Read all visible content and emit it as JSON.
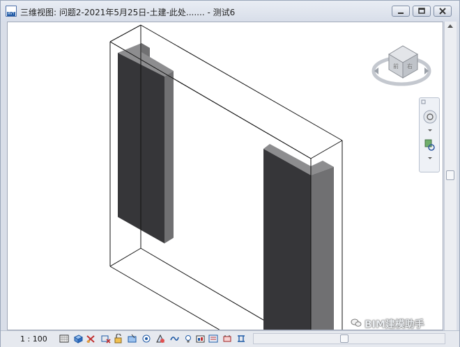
{
  "window": {
    "title": "三维视图: 问题2-2021年5月25日-土建-此处....... - 测试6",
    "app_icon": "RVT"
  },
  "status": {
    "scale": "1 : 100"
  },
  "viewcube": {
    "faces": [
      "前",
      "右"
    ]
  },
  "watermark": {
    "text": "BIM建模助手"
  },
  "toolbar_icons": [
    "visual-style-icon",
    "shadows-icon",
    "crop-icon",
    "crop-region-icon",
    "unlock-3d-icon",
    "temporary-hide-icon",
    "reveal-hidden-icon",
    "render-icon",
    "worksharing-icon",
    "lightbulb-icon",
    "analysis-icon",
    "temporary-view-icon",
    "constraints-icon",
    "highlight-icon"
  ],
  "colors": {
    "column_dark": "#363639",
    "column_side": "#707072",
    "column_top": "#8d8d8f",
    "viewport_bg": "#ffffff",
    "title_bg": "#dfe4ed"
  }
}
